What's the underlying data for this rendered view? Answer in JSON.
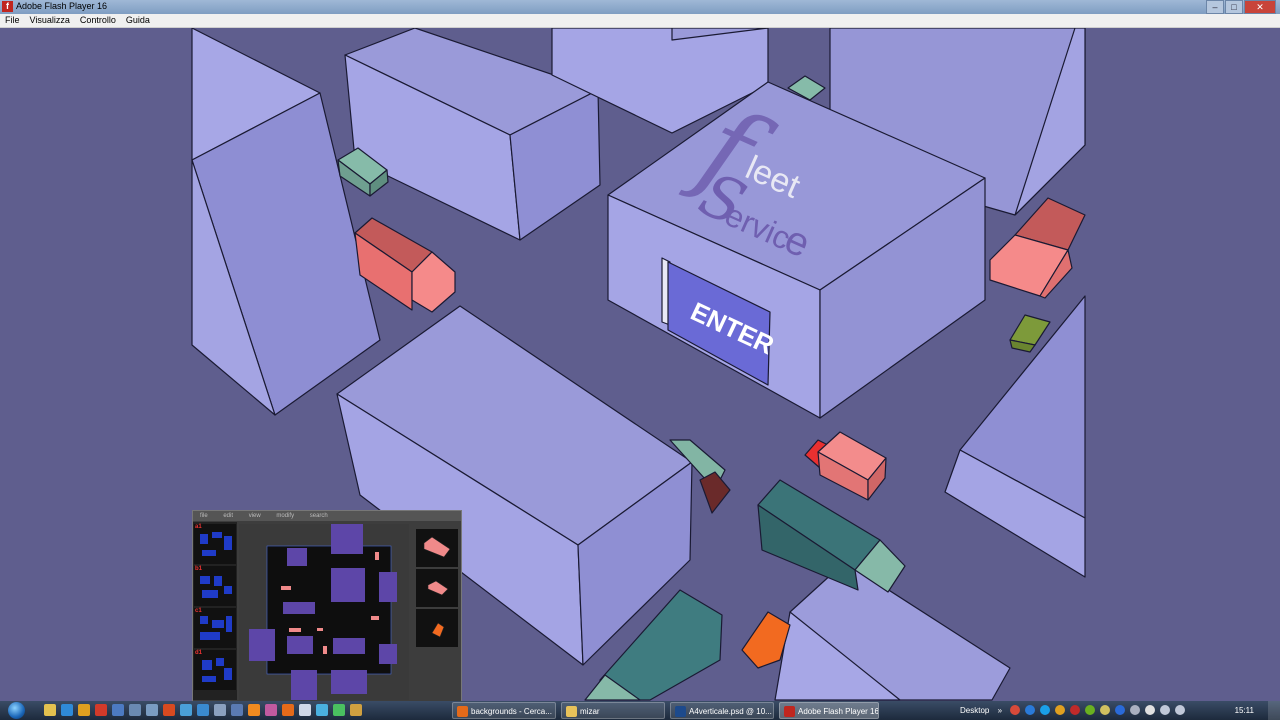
{
  "window": {
    "title": "Adobe Flash Player 16",
    "minimize": "–",
    "maximize": "□",
    "close": "✕"
  },
  "menu": [
    "File",
    "Visualizza",
    "Controllo",
    "Guida"
  ],
  "scene": {
    "logo_letter_f": "f",
    "logo_rest_f": "leet",
    "logo_letter_s": "S",
    "logo_rest_s": "ervic",
    "logo_end": "e",
    "enter_sign": "ENTER",
    "colors": {
      "ground": "#5f5e8e",
      "building_top": "#9797d6",
      "building_side": "#a3a3e4",
      "truck_red": "#f07a7a",
      "truck_teal": "#3f7c80",
      "truck_mint": "#7fb5a6"
    }
  },
  "editor": {
    "menu": [
      "file",
      "edit",
      "view",
      "modify",
      "search"
    ],
    "levels": [
      "a1",
      "b1",
      "c1",
      "d1"
    ]
  },
  "taskbar": {
    "tasks": [
      {
        "label": "backgrounds - Cerca...",
        "icon_color": "#e56a1a"
      },
      {
        "label": "mizar",
        "icon_color": "#e8c25a"
      },
      {
        "label": "A4verticale.psd @ 10...",
        "icon_color": "#1d4a8c"
      },
      {
        "label": "Adobe Flash Player 16",
        "icon_color": "#c0261f"
      }
    ],
    "desktop_label": "Desktop",
    "toolbar_chevron": "»",
    "time": "15:11"
  }
}
